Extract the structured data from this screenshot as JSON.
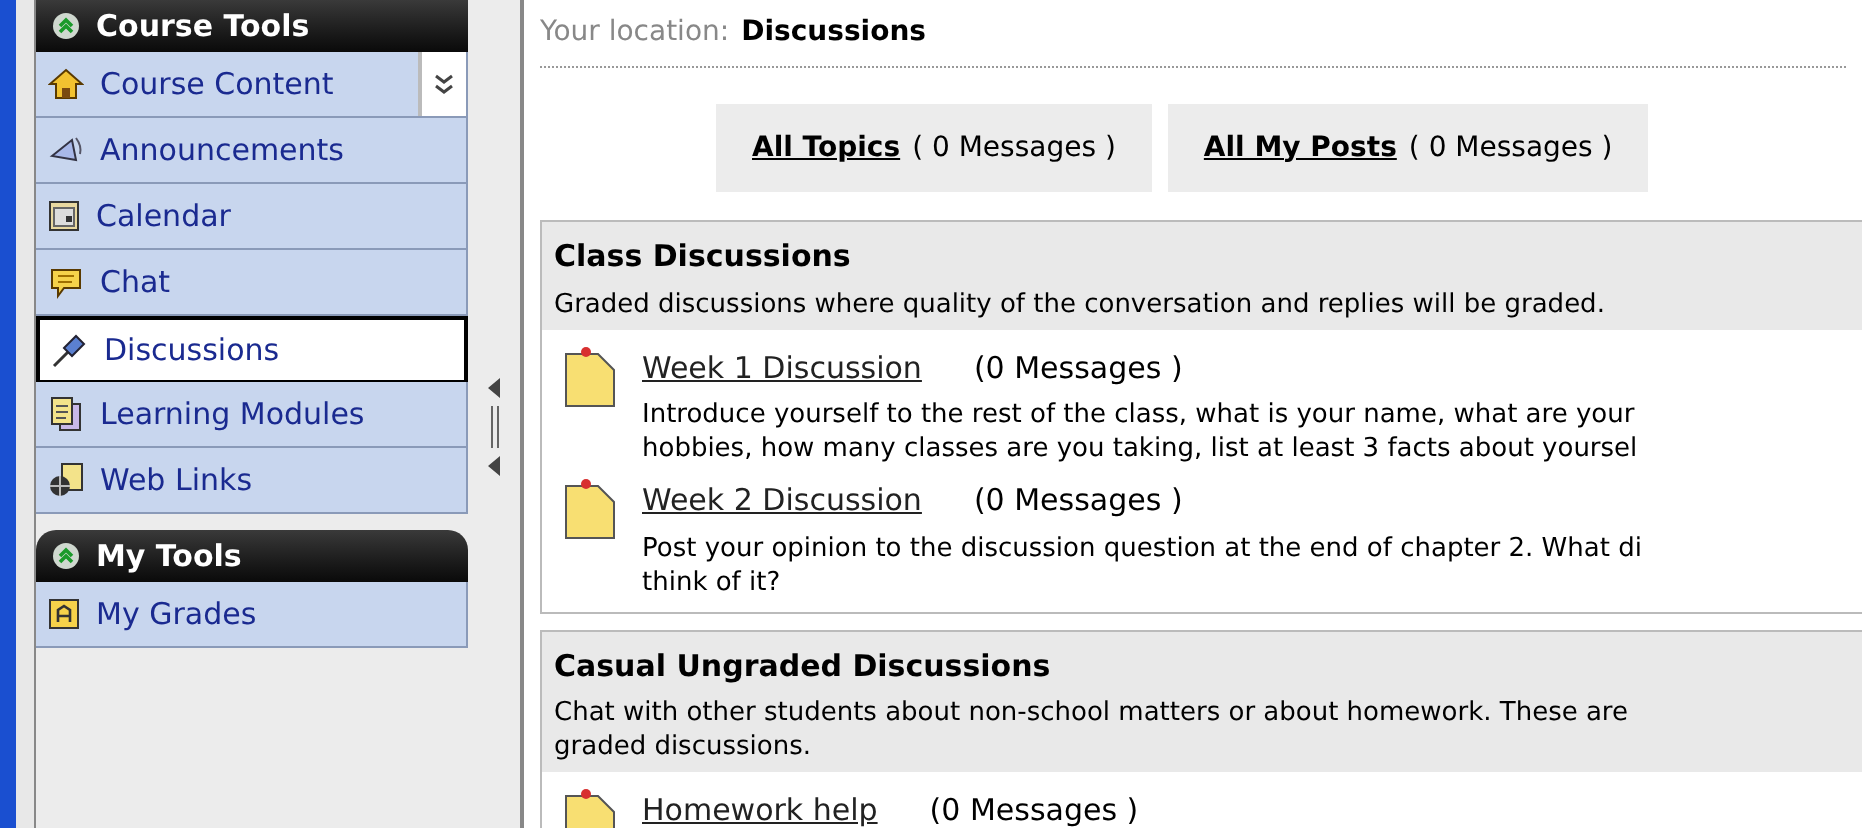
{
  "sidebar": {
    "groups": [
      {
        "title": "Course Tools",
        "items": [
          {
            "label": "Course Content",
            "kind": "home",
            "selected": false,
            "menu_button": true
          },
          {
            "label": "Announcements",
            "kind": "megaphone",
            "selected": false,
            "menu_button": false
          },
          {
            "label": "Calendar",
            "kind": "calendar",
            "selected": false,
            "menu_button": false
          },
          {
            "label": "Chat",
            "kind": "chat",
            "selected": false,
            "menu_button": false
          },
          {
            "label": "Discussions",
            "kind": "pin",
            "selected": true,
            "menu_button": false
          },
          {
            "label": "Learning Modules",
            "kind": "pages",
            "selected": false,
            "menu_button": false
          },
          {
            "label": "Web Links",
            "kind": "globe",
            "selected": false,
            "menu_button": false
          }
        ]
      },
      {
        "title": "My Tools",
        "items": [
          {
            "label": "My Grades",
            "kind": "grades",
            "selected": false,
            "menu_button": false
          }
        ]
      }
    ]
  },
  "breadcrumb": {
    "label": "Your location:",
    "current": "Discussions"
  },
  "summary": [
    {
      "link": "All Topics",
      "count": "( 0 Messages )"
    },
    {
      "link": "All My Posts",
      "count": "( 0 Messages )"
    }
  ],
  "categories": [
    {
      "title": "Class Discussions",
      "description": "Graded discussions where quality of the conversation and replies will be graded.",
      "topics": [
        {
          "title": "Week 1 Discussion",
          "count": "(0 Messages )",
          "description": "Introduce yourself to the rest of the class, what is your name, what are your\nhobbies, how many classes are you taking, list at least 3 facts about yoursel"
        },
        {
          "title": "Week 2 Discussion",
          "count": "(0 Messages )",
          "description": "Post your opinion to the discussion question at the end of chapter 2. What di\nthink of it?"
        }
      ]
    },
    {
      "title": "Casual Ungraded Discussions",
      "description": "Chat with other students about non-school matters or about homework. These are\ngraded discussions.",
      "topics": [
        {
          "title": "Homework help",
          "count": "(0 Messages )"
        }
      ]
    }
  ]
}
